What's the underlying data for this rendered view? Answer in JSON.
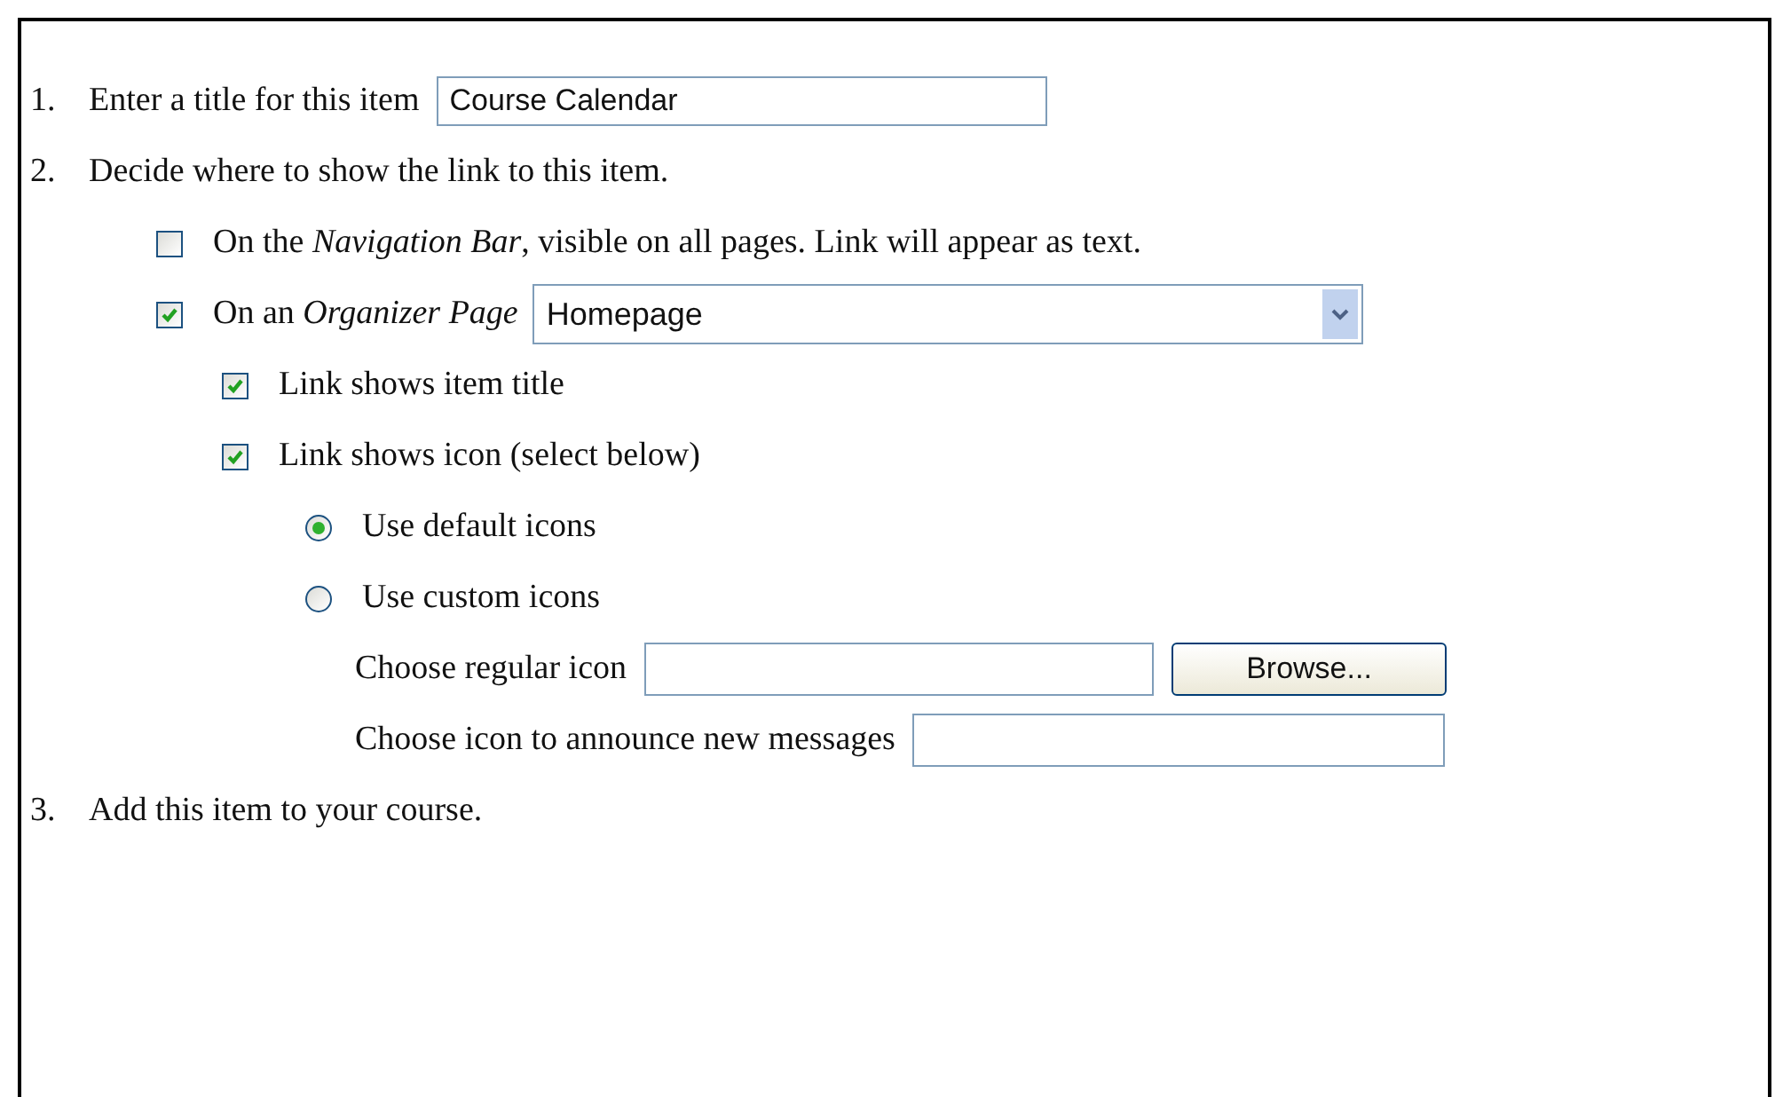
{
  "steps": [
    {
      "number": "1.",
      "text": "Enter a title for this item",
      "title_field": {
        "value": "Course Calendar"
      }
    },
    {
      "number": "2.",
      "text": "Decide where to show the link to this item.",
      "options": [
        {
          "kind": "checkbox",
          "label": "On the *Navigation Bar*, visible on all pages. Link will appear as text.",
          "checked": false
        },
        {
          "kind": "checkbox",
          "label": "On an *Organizer Page*",
          "checked": true,
          "select": {
            "value": "Homepage"
          },
          "children": [
            {
              "kind": "checkbox",
              "label": "Link shows item title",
              "checked": true
            },
            {
              "kind": "checkbox",
              "label": "Link shows icon (select below)",
              "checked": true,
              "children": [
                {
                  "kind": "radio",
                  "label": "Use default icons",
                  "selected": true
                },
                {
                  "kind": "radio",
                  "label": "Use custom icons",
                  "selected": false,
                  "children": [
                    {
                      "kind": "file",
                      "label": "Choose regular icon",
                      "button": "Browse..."
                    },
                    {
                      "kind": "file",
                      "label": "Choose icon to announce new messages"
                    }
                  ]
                }
              ]
            }
          ]
        }
      ]
    },
    {
      "number": "3.",
      "text": "Add this item to your course."
    }
  ]
}
